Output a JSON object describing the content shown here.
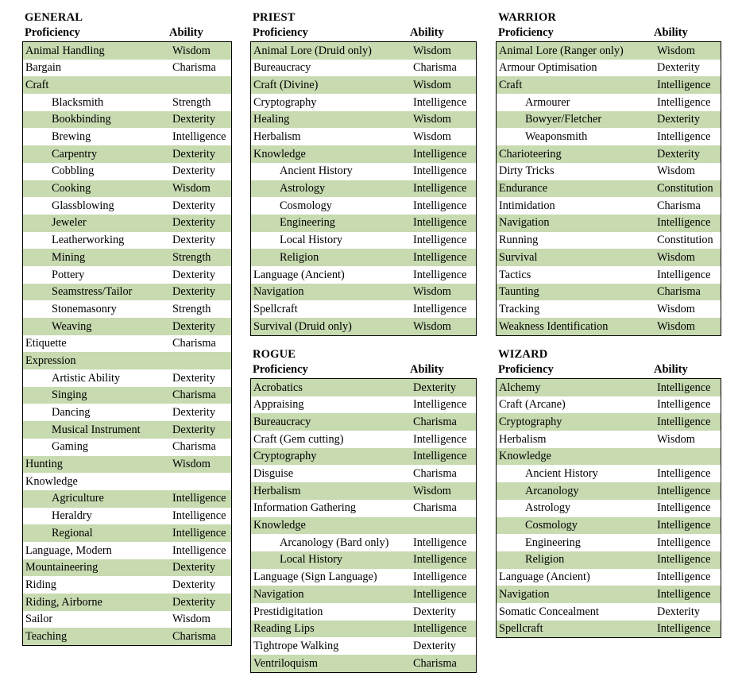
{
  "columns": {
    "proficiency_header": "Proficiency",
    "ability_header": "Ability"
  },
  "colors": {
    "row_shade": "#c7dab0",
    "row_plain": "#ffffff",
    "border": "#000000",
    "text": "#000000"
  },
  "tables": [
    {
      "id": "general",
      "title": "GENERAL",
      "rows": [
        {
          "name": "Animal Handling",
          "ability": "Wisdom",
          "indent": 0,
          "shaded": true
        },
        {
          "name": "Bargain",
          "ability": "Charisma",
          "indent": 0,
          "shaded": false
        },
        {
          "name": "Craft",
          "ability": "",
          "indent": 0,
          "shaded": true
        },
        {
          "name": "Blacksmith",
          "ability": "Strength",
          "indent": 1,
          "shaded": false
        },
        {
          "name": "Bookbinding",
          "ability": "Dexterity",
          "indent": 1,
          "shaded": true
        },
        {
          "name": "Brewing",
          "ability": "Intelligence",
          "indent": 1,
          "shaded": false
        },
        {
          "name": "Carpentry",
          "ability": "Dexterity",
          "indent": 1,
          "shaded": true
        },
        {
          "name": "Cobbling",
          "ability": "Dexterity",
          "indent": 1,
          "shaded": false
        },
        {
          "name": "Cooking",
          "ability": "Wisdom",
          "indent": 1,
          "shaded": true
        },
        {
          "name": "Glassblowing",
          "ability": "Dexterity",
          "indent": 1,
          "shaded": false
        },
        {
          "name": "Jeweler",
          "ability": "Dexterity",
          "indent": 1,
          "shaded": true
        },
        {
          "name": "Leatherworking",
          "ability": "Dexterity",
          "indent": 1,
          "shaded": false
        },
        {
          "name": "Mining",
          "ability": "Strength",
          "indent": 1,
          "shaded": true
        },
        {
          "name": "Pottery",
          "ability": "Dexterity",
          "indent": 1,
          "shaded": false
        },
        {
          "name": "Seamstress/Tailor",
          "ability": "Dexterity",
          "indent": 1,
          "shaded": true
        },
        {
          "name": "Stonemasonry",
          "ability": "Strength",
          "indent": 1,
          "shaded": false
        },
        {
          "name": "Weaving",
          "ability": "Dexterity",
          "indent": 1,
          "shaded": true
        },
        {
          "name": "Etiquette",
          "ability": "Charisma",
          "indent": 0,
          "shaded": false
        },
        {
          "name": "Expression",
          "ability": "",
          "indent": 0,
          "shaded": true
        },
        {
          "name": "Artistic Ability",
          "ability": "Dexterity",
          "indent": 1,
          "shaded": false
        },
        {
          "name": "Singing",
          "ability": "Charisma",
          "indent": 1,
          "shaded": true
        },
        {
          "name": "Dancing",
          "ability": "Dexterity",
          "indent": 1,
          "shaded": false
        },
        {
          "name": "Musical Instrument",
          "ability": "Dexterity",
          "indent": 1,
          "shaded": true
        },
        {
          "name": "Gaming",
          "ability": "Charisma",
          "indent": 1,
          "shaded": false
        },
        {
          "name": "Hunting",
          "ability": "Wisdom",
          "indent": 0,
          "shaded": true
        },
        {
          "name": "Knowledge",
          "ability": "",
          "indent": 0,
          "shaded": false
        },
        {
          "name": "Agriculture",
          "ability": "Intelligence",
          "indent": 1,
          "shaded": true
        },
        {
          "name": "Heraldry",
          "ability": "Intelligence",
          "indent": 1,
          "shaded": false
        },
        {
          "name": "Regional",
          "ability": "Intelligence",
          "indent": 1,
          "shaded": true
        },
        {
          "name": "Language, Modern",
          "ability": "Intelligence",
          "indent": 0,
          "shaded": false
        },
        {
          "name": "Mountaineering",
          "ability": "Dexterity",
          "indent": 0,
          "shaded": true
        },
        {
          "name": "Riding",
          "ability": "Dexterity",
          "indent": 0,
          "shaded": false
        },
        {
          "name": "Riding, Airborne",
          "ability": "Dexterity",
          "indent": 0,
          "shaded": true
        },
        {
          "name": "Sailor",
          "ability": "Wisdom",
          "indent": 0,
          "shaded": false
        },
        {
          "name": "Teaching",
          "ability": "Charisma",
          "indent": 0,
          "shaded": true
        }
      ]
    },
    {
      "id": "priest",
      "title": "PRIEST",
      "rows": [
        {
          "name": "Animal Lore (Druid only)",
          "ability": "Wisdom",
          "indent": 0,
          "shaded": true
        },
        {
          "name": "Bureaucracy",
          "ability": "Charisma",
          "indent": 0,
          "shaded": false
        },
        {
          "name": "Craft (Divine)",
          "ability": "Wisdom",
          "indent": 0,
          "shaded": true
        },
        {
          "name": "Cryptography",
          "ability": "Intelligence",
          "indent": 0,
          "shaded": false
        },
        {
          "name": "Healing",
          "ability": "Wisdom",
          "indent": 0,
          "shaded": true
        },
        {
          "name": "Herbalism",
          "ability": "Wisdom",
          "indent": 0,
          "shaded": false
        },
        {
          "name": "Knowledge",
          "ability": "Intelligence",
          "indent": 0,
          "shaded": true
        },
        {
          "name": "Ancient History",
          "ability": "Intelligence",
          "indent": 1,
          "shaded": false
        },
        {
          "name": "Astrology",
          "ability": "Intelligence",
          "indent": 1,
          "shaded": true
        },
        {
          "name": "Cosmology",
          "ability": "Intelligence",
          "indent": 1,
          "shaded": false
        },
        {
          "name": "Engineering",
          "ability": "Intelligence",
          "indent": 1,
          "shaded": true
        },
        {
          "name": "Local History",
          "ability": "Intelligence",
          "indent": 1,
          "shaded": false
        },
        {
          "name": "Religion",
          "ability": "Intelligence",
          "indent": 1,
          "shaded": true
        },
        {
          "name": "Language (Ancient)",
          "ability": "Intelligence",
          "indent": 0,
          "shaded": false
        },
        {
          "name": "Navigation",
          "ability": "Wisdom",
          "indent": 0,
          "shaded": true
        },
        {
          "name": "Spellcraft",
          "ability": "Intelligence",
          "indent": 0,
          "shaded": false
        },
        {
          "name": "Survival (Druid only)",
          "ability": "Wisdom",
          "indent": 0,
          "shaded": true
        }
      ]
    },
    {
      "id": "rogue",
      "title": "ROGUE",
      "rows": [
        {
          "name": "Acrobatics",
          "ability": "Dexterity",
          "indent": 0,
          "shaded": true
        },
        {
          "name": "Appraising",
          "ability": "Intelligence",
          "indent": 0,
          "shaded": false
        },
        {
          "name": "Bureaucracy",
          "ability": "Charisma",
          "indent": 0,
          "shaded": true
        },
        {
          "name": "Craft (Gem cutting)",
          "ability": "Intelligence",
          "indent": 0,
          "shaded": false
        },
        {
          "name": "Cryptography",
          "ability": "Intelligence",
          "indent": 0,
          "shaded": true
        },
        {
          "name": "Disguise",
          "ability": "Charisma",
          "indent": 0,
          "shaded": false
        },
        {
          "name": "Herbalism",
          "ability": "Wisdom",
          "indent": 0,
          "shaded": true
        },
        {
          "name": "Information Gathering",
          "ability": "Charisma",
          "indent": 0,
          "shaded": false
        },
        {
          "name": "Knowledge",
          "ability": "",
          "indent": 0,
          "shaded": true
        },
        {
          "name": "Arcanology (Bard only)",
          "ability": "Intelligence",
          "indent": 1,
          "shaded": false
        },
        {
          "name": "Local History",
          "ability": "Intelligence",
          "indent": 1,
          "shaded": true
        },
        {
          "name": "Language (Sign Language)",
          "ability": "Intelligence",
          "indent": 0,
          "shaded": false
        },
        {
          "name": "Navigation",
          "ability": "Intelligence",
          "indent": 0,
          "shaded": true
        },
        {
          "name": "Prestidigitation",
          "ability": "Dexterity",
          "indent": 0,
          "shaded": false
        },
        {
          "name": "Reading Lips",
          "ability": "Intelligence",
          "indent": 0,
          "shaded": true
        },
        {
          "name": "Tightrope Walking",
          "ability": "Dexterity",
          "indent": 0,
          "shaded": false
        },
        {
          "name": "Ventriloquism",
          "ability": "Charisma",
          "indent": 0,
          "shaded": true
        }
      ]
    },
    {
      "id": "warrior",
      "title": "WARRIOR",
      "rows": [
        {
          "name": "Animal Lore (Ranger only)",
          "ability": "Wisdom",
          "indent": 0,
          "shaded": true
        },
        {
          "name": "Armour Optimisation",
          "ability": "Dexterity",
          "indent": 0,
          "shaded": false
        },
        {
          "name": "Craft",
          "ability": "Intelligence",
          "indent": 0,
          "shaded": true
        },
        {
          "name": "Armourer",
          "ability": "Intelligence",
          "indent": 1,
          "shaded": false
        },
        {
          "name": "Bowyer/Fletcher",
          "ability": "Dexterity",
          "indent": 1,
          "shaded": true
        },
        {
          "name": "Weaponsmith",
          "ability": "Intelligence",
          "indent": 1,
          "shaded": false
        },
        {
          "name": "Charioteering",
          "ability": "Dexterity",
          "indent": 0,
          "shaded": true
        },
        {
          "name": "Dirty Tricks",
          "ability": "Wisdom",
          "indent": 0,
          "shaded": false
        },
        {
          "name": "Endurance",
          "ability": "Constitution",
          "indent": 0,
          "shaded": true
        },
        {
          "name": "Intimidation",
          "ability": "Charisma",
          "indent": 0,
          "shaded": false
        },
        {
          "name": "Navigation",
          "ability": "Intelligence",
          "indent": 0,
          "shaded": true
        },
        {
          "name": "Running",
          "ability": "Constitution",
          "indent": 0,
          "shaded": false
        },
        {
          "name": "Survival",
          "ability": "Wisdom",
          "indent": 0,
          "shaded": true
        },
        {
          "name": "Tactics",
          "ability": "Intelligence",
          "indent": 0,
          "shaded": false
        },
        {
          "name": "Taunting",
          "ability": "Charisma",
          "indent": 0,
          "shaded": true
        },
        {
          "name": "Tracking",
          "ability": "Wisdom",
          "indent": 0,
          "shaded": false
        },
        {
          "name": "Weakness Identification",
          "ability": "Wisdom",
          "indent": 0,
          "shaded": true
        }
      ]
    },
    {
      "id": "wizard",
      "title": "WIZARD",
      "rows": [
        {
          "name": "Alchemy",
          "ability": "Intelligence",
          "indent": 0,
          "shaded": true
        },
        {
          "name": "Craft (Arcane)",
          "ability": "Intelligence",
          "indent": 0,
          "shaded": false
        },
        {
          "name": "Cryptography",
          "ability": "Intelligence",
          "indent": 0,
          "shaded": true
        },
        {
          "name": "Herbalism",
          "ability": "Wisdom",
          "indent": 0,
          "shaded": false
        },
        {
          "name": "Knowledge",
          "ability": "",
          "indent": 0,
          "shaded": true
        },
        {
          "name": "Ancient History",
          "ability": "Intelligence",
          "indent": 1,
          "shaded": false
        },
        {
          "name": "Arcanology",
          "ability": "Intelligence",
          "indent": 1,
          "shaded": true
        },
        {
          "name": "Astrology",
          "ability": "Intelligence",
          "indent": 1,
          "shaded": false
        },
        {
          "name": "Cosmology",
          "ability": "Intelligence",
          "indent": 1,
          "shaded": true
        },
        {
          "name": "Engineering",
          "ability": "Intelligence",
          "indent": 1,
          "shaded": false
        },
        {
          "name": "Religion",
          "ability": "Intelligence",
          "indent": 1,
          "shaded": true
        },
        {
          "name": "Language (Ancient)",
          "ability": "Intelligence",
          "indent": 0,
          "shaded": false
        },
        {
          "name": "Navigation",
          "ability": "Intelligence",
          "indent": 0,
          "shaded": true
        },
        {
          "name": "Somatic Concealment",
          "ability": "Dexterity",
          "indent": 0,
          "shaded": false
        },
        {
          "name": "Spellcraft",
          "ability": "Intelligence",
          "indent": 0,
          "shaded": true
        }
      ]
    }
  ]
}
